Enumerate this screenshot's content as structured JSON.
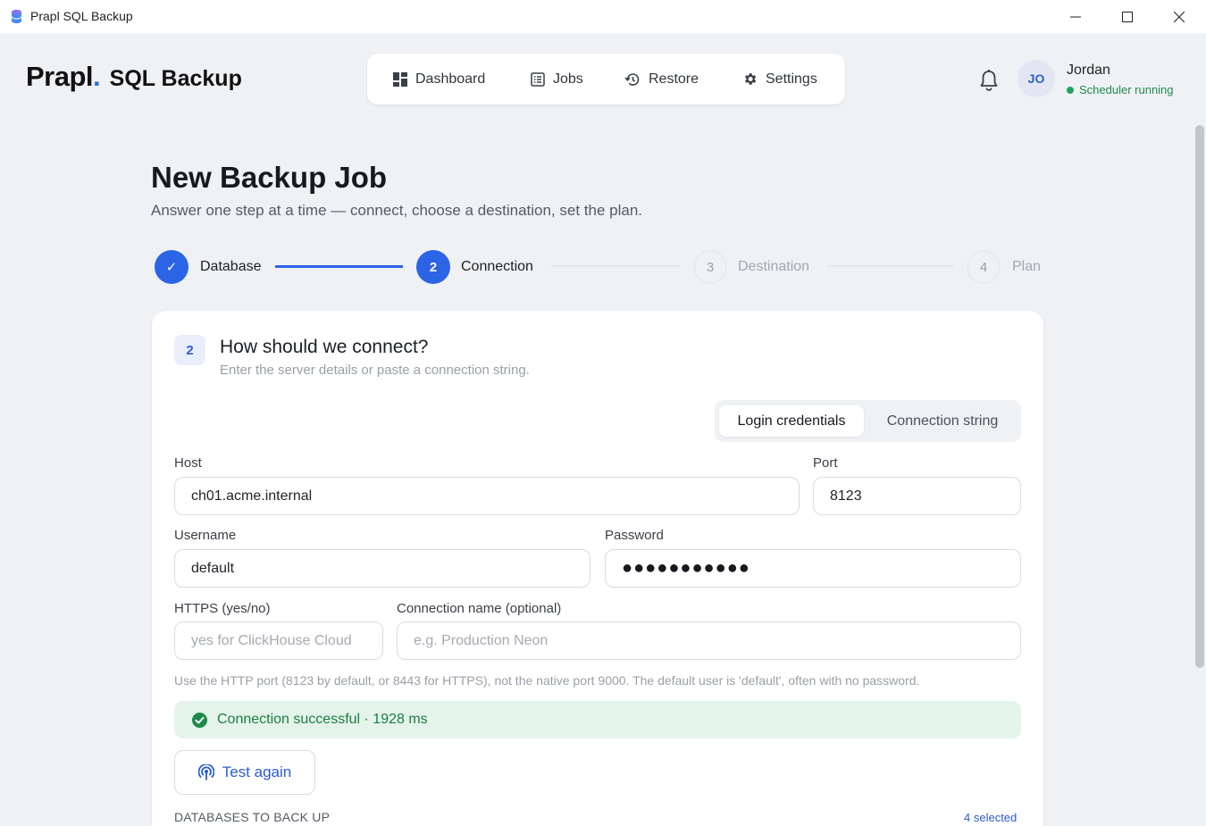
{
  "window": {
    "title": "Prapl SQL Backup",
    "minimize_icon": "minimize-icon",
    "maximize_icon": "maximize-icon",
    "close_icon": "close-icon"
  },
  "header": {
    "brand": "Prapl",
    "brand_dot": ".",
    "product": "SQL Backup",
    "nav": [
      {
        "label": "Dashboard",
        "icon": "dashboard-icon"
      },
      {
        "label": "Jobs",
        "icon": "list-icon"
      },
      {
        "label": "Restore",
        "icon": "restore-icon"
      },
      {
        "label": "Settings",
        "icon": "gear-icon"
      }
    ],
    "user": {
      "initials": "JO",
      "name": "Jordan",
      "status": "Scheduler running"
    }
  },
  "page": {
    "title": "New Backup Job",
    "subtitle": "Answer one step at a time — connect, choose a destination, set the plan."
  },
  "stepper": [
    {
      "number": "✓",
      "label": "Database",
      "state": "done"
    },
    {
      "number": "2",
      "label": "Connection",
      "state": "active"
    },
    {
      "number": "3",
      "label": "Destination",
      "state": "pending"
    },
    {
      "number": "4",
      "label": "Plan",
      "state": "pending"
    }
  ],
  "card": {
    "step_number": "2",
    "title": "How should we connect?",
    "subtitle": "Enter the server details or paste a connection string.",
    "mode_tabs": [
      "Login credentials",
      "Connection string"
    ],
    "fields": {
      "host": {
        "label": "Host",
        "value": "ch01.acme.internal"
      },
      "port": {
        "label": "Port",
        "value": "8123"
      },
      "username": {
        "label": "Username",
        "value": "default"
      },
      "password": {
        "label": "Password",
        "value": "●●●●●●●●●●●"
      },
      "https": {
        "label": "HTTPS (yes/no)",
        "placeholder": "yes for ClickHouse Cloud"
      },
      "connection_name": {
        "label": "Connection name (optional)",
        "placeholder": "e.g. Production Neon"
      }
    },
    "hint": "Use the HTTP port (8123 by default, or 8443 for HTTPS), not the native port 9000. The default user is 'default', often with no password.",
    "status": "Connection successful · 1928 ms",
    "test_button": "Test again",
    "databases_heading": "DATABASES TO BACK UP",
    "databases_count": "4 selected"
  },
  "colors": {
    "accent": "#2c64e6",
    "success_bg": "#e4f4ea",
    "success_text": "#1c7c43",
    "background": "#eff1f4"
  }
}
